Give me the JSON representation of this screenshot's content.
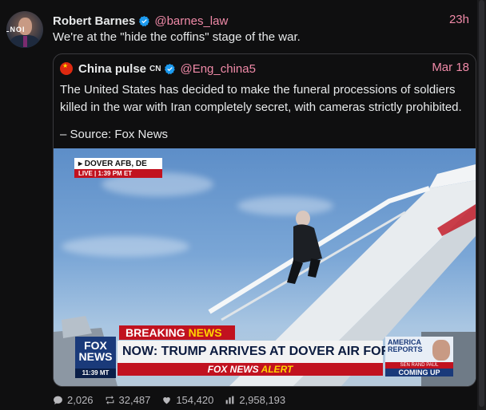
{
  "colors": {
    "accent": "#f08aa8",
    "verified": "#1d9bf0",
    "background": "#0f0f10"
  },
  "tweet": {
    "author_name": "Robert Barnes",
    "handle": "@barnes_law",
    "time": "23h",
    "text": "We're at the \"hide the coffins\" stage of the war.",
    "avatar_icon": "avatar-image"
  },
  "quote": {
    "author_name": "China pulse",
    "badge": "CN",
    "handle": "@Eng_china5",
    "date": "Mar 18",
    "text": "The United States has decided to make the funeral processions of soldiers killed in the war with Iran completely secret, with cameras strictly prohibited.",
    "source": "– Source: Fox News",
    "media": {
      "location": "▸ DOVER AFB, DE",
      "live": "LIVE",
      "live_time": "1:39 PM ET",
      "breaking_1": "BREAKING",
      "breaking_2": "NEWS",
      "network": "FOX NEWS",
      "network_time": "11:39 MT",
      "headline": "NOW: TRUMP ARRIVES AT DOVER AIR FORCE BASE",
      "alert_1": "FOX NEWS",
      "alert_2": "ALERT",
      "promo_title": "AMERICA REPORTS",
      "promo_sub": "SEN RAND PAUL",
      "promo_coming": "COMING UP"
    }
  },
  "metrics": {
    "replies": "2,026",
    "retweets": "32,487",
    "likes": "154,420",
    "views": "2,958,193"
  }
}
